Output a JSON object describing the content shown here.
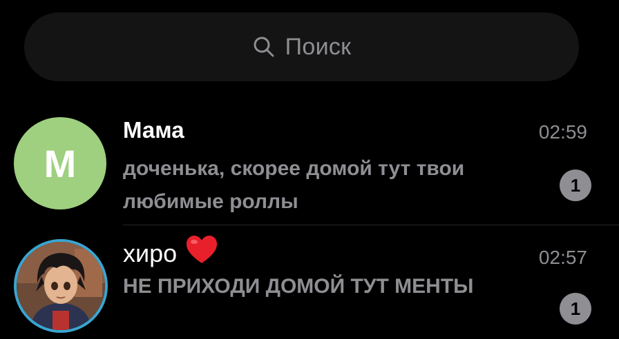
{
  "search": {
    "placeholder": "Поиск",
    "icon": "search-icon"
  },
  "chats": [
    {
      "avatar_initial": "M",
      "avatar_color": "#9ed07f",
      "name": "Мама",
      "time": "02:59",
      "preview": "доченька, скорее домой тут твои любимые роллы",
      "unread": "1"
    },
    {
      "avatar": "photo",
      "avatar_ring_color": "#3aa5d1",
      "name": "хиро",
      "name_emoji": "heart-icon",
      "time": "02:57",
      "preview": "НЕ ПРИХОДИ ДОМОЙ ТУТ МЕНТЫ",
      "unread": "1"
    }
  ],
  "colors": {
    "background": "#000000",
    "search_bg": "#141414",
    "secondary_text": "#8e8e93",
    "badge": "#8e8e93",
    "heart": "#e8202c"
  }
}
